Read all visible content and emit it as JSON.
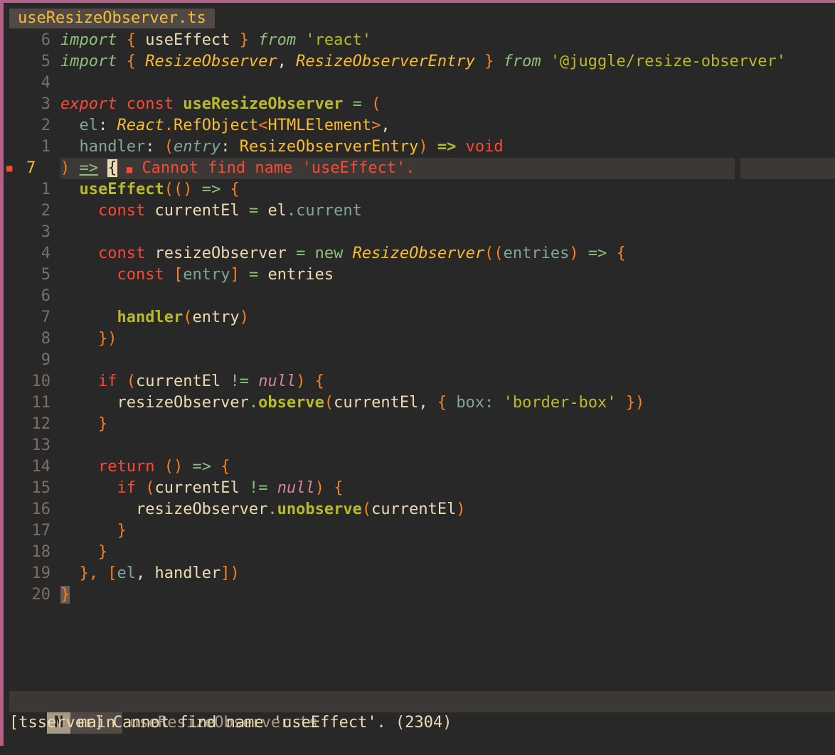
{
  "tab": {
    "filename": "useResizeObserver.ts"
  },
  "lines": [
    {
      "num": "6"
    },
    {
      "num": "5"
    },
    {
      "num": "4"
    },
    {
      "num": "3"
    },
    {
      "num": "2"
    },
    {
      "num": "1"
    },
    {
      "num": "7"
    },
    {
      "num": "1"
    },
    {
      "num": "2"
    },
    {
      "num": "3"
    },
    {
      "num": "4"
    },
    {
      "num": "5"
    },
    {
      "num": "6"
    },
    {
      "num": "7"
    },
    {
      "num": "8"
    },
    {
      "num": "9"
    },
    {
      "num": "10"
    },
    {
      "num": "11"
    },
    {
      "num": "12"
    },
    {
      "num": "13"
    },
    {
      "num": "14"
    },
    {
      "num": "15"
    },
    {
      "num": "16"
    },
    {
      "num": "17"
    },
    {
      "num": "18"
    },
    {
      "num": "19"
    },
    {
      "num": "20"
    }
  ],
  "code": {
    "l1": {
      "import": "import",
      "ob": "{",
      "name": " useEffect ",
      "cb": "}",
      "from": "from",
      "str": "'react'"
    },
    "l2": {
      "import": "import",
      "ob": "{",
      "a": " ResizeObserver",
      "comma": ",",
      "b": " ResizeObserverEntry ",
      "cb": "}",
      "from": "from",
      "str": "'@juggle/resize-observer'"
    },
    "l4": {
      "export": "export",
      "const": "const",
      "name": "useResizeObserver",
      "eq": "=",
      "paren": "("
    },
    "l5": {
      "el": "el",
      "colon": ":",
      "react": "React",
      "dot": ".",
      "ref": "RefObject",
      "lt": "<",
      "html": "HTMLElement",
      "gt": ">",
      "comma": ","
    },
    "l6": {
      "handler": "handler",
      "colon": ":",
      "po": "(",
      "entry": "entry",
      "colon2": ":",
      "type": "ResizeObserverEntry",
      "pc": ")",
      "arrow": "=>",
      "void": "void"
    },
    "l7": {
      "pc": ")",
      "arrow": "=>",
      "brace": "{",
      "diag_sign": "■",
      "diag_msg": "Cannot find name 'useEffect'."
    },
    "l8": {
      "fn": "useEffect",
      "po": "(()",
      "arrow": "=>",
      "brace": "{"
    },
    "l9": {
      "const": "const",
      "name": "currentEl",
      "eq": "=",
      "el": "el",
      "dot": ".",
      "prop": "current"
    },
    "l11": {
      "const": "const",
      "name": "resizeObserver",
      "eq": "=",
      "new": "new",
      "cls": "ResizeObserver",
      "po": "((",
      "entries": "entries",
      "pc": ")",
      "arrow": "=>",
      "brace": "{"
    },
    "l12": {
      "const": "const",
      "bo": "[",
      "entry": "entry",
      "bc": "]",
      "eq": "=",
      "entries": "entries"
    },
    "l14": {
      "fn": "handler",
      "po": "(",
      "arg": "entry",
      "pc": ")"
    },
    "l15": {
      "close": "})"
    },
    "l17": {
      "if": "if",
      "po": "(",
      "a": "currentEl",
      "neq": "!=",
      "nul": "null",
      "pc": ")",
      "brace": "{"
    },
    "l18": {
      "obj": "resizeObserver",
      "dot": ".",
      "fn": "observe",
      "po": "(",
      "arg": "currentEl",
      "comma": ",",
      "bo": "{",
      "key": "box",
      "colon": ":",
      "str": "'border-box'",
      "bc": "})"
    },
    "l19": {
      "brace": "}"
    },
    "l21": {
      "ret": "return",
      "paren": "()",
      "arrow": "=>",
      "brace": "{"
    },
    "l22": {
      "if": "if",
      "po": "(",
      "a": "currentEl",
      "neq": "!=",
      "nul": "null",
      "pc": ")",
      "brace": "{"
    },
    "l23": {
      "obj": "resizeObserver",
      "dot": ".",
      "fn": "unobserve",
      "po": "(",
      "arg": "currentEl",
      "pc": ")"
    },
    "l24": {
      "brace": "}"
    },
    "l25": {
      "brace": "}"
    },
    "l26": {
      "close": "},",
      "bo": "[",
      "a": "el",
      "comma": ",",
      "b": "handler",
      "bc": "])"
    },
    "l27": {
      "brace": "}"
    }
  },
  "statusline": {
    "mode": "N",
    "branch": "main",
    "filename": "useResizeObserver.ts"
  },
  "cmdline": {
    "message": "[tsserver] Cannot find name 'useEffect'. (2304)"
  },
  "colors": {
    "accent_border": "#b16286",
    "error": "#fb4934",
    "keyword": "#fb4934",
    "function": "#b8bb26",
    "bracket": "#fe8019",
    "background": "#282828"
  }
}
